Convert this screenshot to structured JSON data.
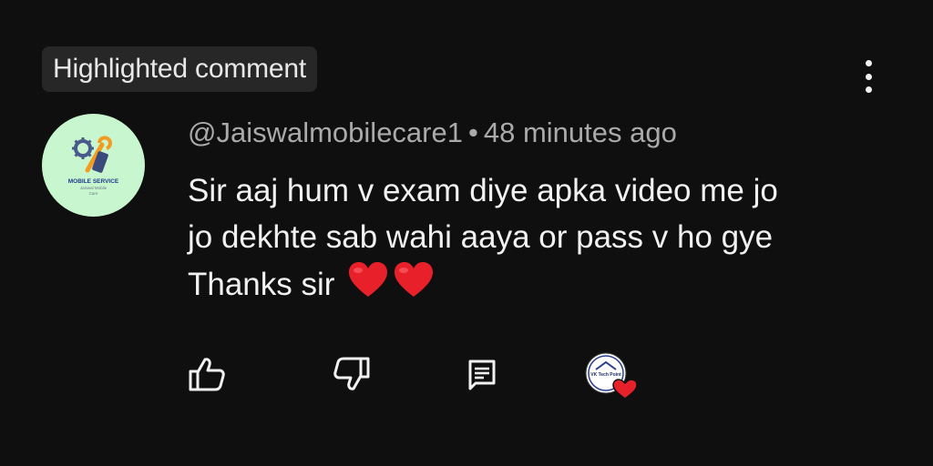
{
  "badge": {
    "label": "Highlighted comment"
  },
  "avatar": {
    "logo_text_line1": "MOBILE SERVICE",
    "logo_text_line2": "Jaiswal Mobile",
    "logo_text_line3": "Care",
    "background_color": "#c8f6cf"
  },
  "comment": {
    "author": "@Jaiswalmobilecare1",
    "separator": "•",
    "time": "48 minutes ago",
    "lines": [
      "Sir aaj hum v exam diye apka video me jo",
      "jo dekhte sab wahi aaya or pass v ho gye",
      "Thanks sir"
    ],
    "emoji": [
      "red-heart",
      "red-heart"
    ]
  },
  "actions": {
    "like_icon": "thumbs-up-icon",
    "dislike_icon": "thumbs-down-icon",
    "reply_icon": "reply-icon",
    "creator_heart_icon": "creator-heart-icon",
    "creator_logo_text": "VK Tech Point"
  },
  "more_icon": "more-vertical-icon",
  "colors": {
    "background": "#0f0f0f",
    "badge_bg": "#272727",
    "text_primary": "#f1f1f1",
    "text_secondary": "#aaaaaa",
    "heart": "#e8202a"
  }
}
